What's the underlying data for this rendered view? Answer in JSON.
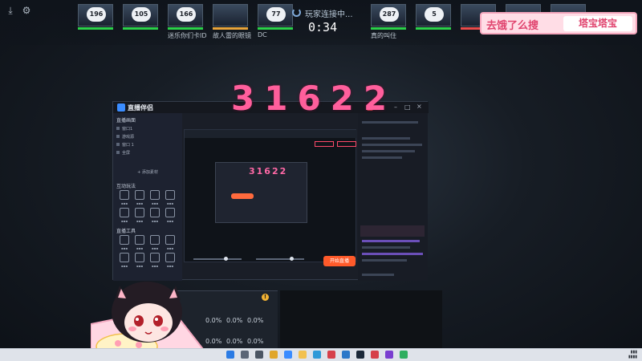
{
  "top_left_icons": [
    "app-icon",
    "settings-icon"
  ],
  "team_left": [
    {
      "badge": "196",
      "name": "",
      "bar": "green"
    },
    {
      "badge": "105",
      "name": "",
      "bar": "green"
    },
    {
      "badge": "166",
      "name": "迷乐你们卡ID",
      "bar": "green"
    },
    {
      "badge": "",
      "name": "故人雷的眼镜",
      "bar": "orange"
    },
    {
      "badge": "77",
      "name": "DC",
      "bar": "green"
    }
  ],
  "center": {
    "status": "玩家连接中...",
    "timer": "0:34"
  },
  "team_right": [
    {
      "badge": "287",
      "name": "真的叫住",
      "bar": "green"
    },
    {
      "badge": "5",
      "name": "",
      "bar": "green"
    },
    {
      "badge": "",
      "name": "",
      "bar": "red"
    },
    {
      "badge": "",
      "name": "",
      "bar": "green"
    },
    {
      "badge": "",
      "name": "",
      "bar": "green"
    }
  ],
  "banner": {
    "left": "去饿了么搜",
    "right": "塔宝塔宝"
  },
  "big_code": "31622",
  "app": {
    "name": "直播伴侣",
    "sidebar_title": "直播画面",
    "sidebar_rows": [
      "窗口1",
      "游戏源",
      "窗口 1",
      "全屏"
    ],
    "add_source": "+ 添加素材",
    "inner_code": "31622",
    "go_live_label": "开始直播",
    "section_tools": "互动玩法",
    "section_more": "直播工具"
  },
  "stats": {
    "values": [
      "0.0%",
      "0.0%",
      "0.0%",
      "0.0%",
      "0.0%",
      "0.0%"
    ],
    "info_icon": "!"
  },
  "taskbar_icons": [
    "start-icon",
    "search-icon",
    "taskview-icon",
    "chrome-icon",
    "explorer-icon",
    "folder-icon",
    "browser-icon",
    "media-icon",
    "mail-icon",
    "steam-icon",
    "game-icon",
    "stream-icon",
    "chat-icon"
  ],
  "colors": {
    "accent_pink": "#ff5f9c",
    "live_orange": "#ff5a2a",
    "banner_pink": "#e0436e"
  }
}
